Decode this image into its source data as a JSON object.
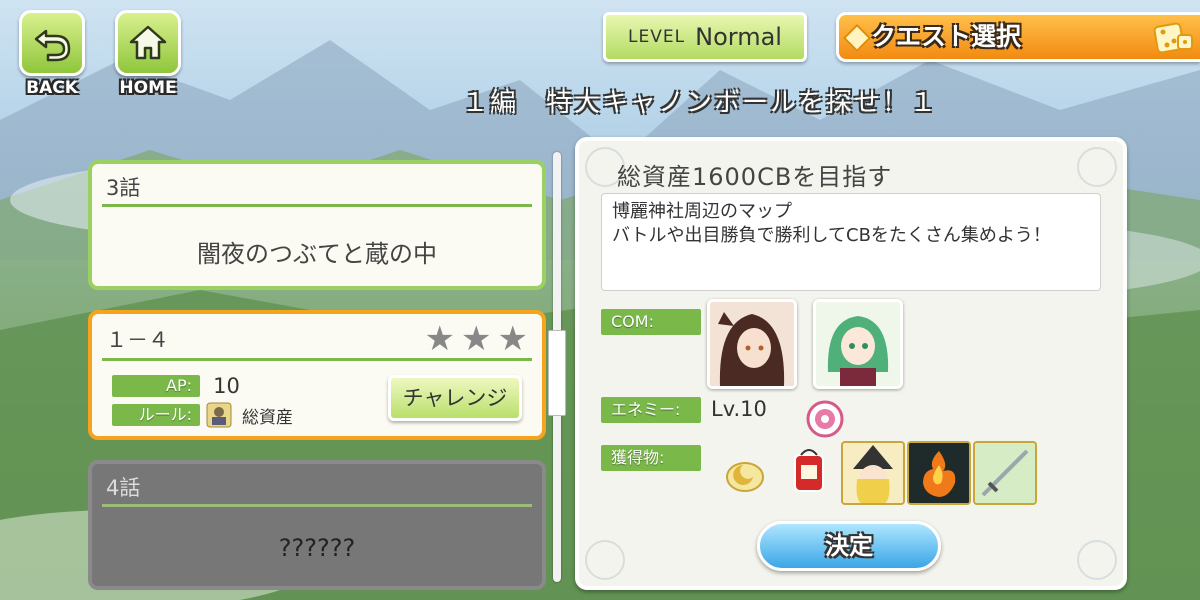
{
  "nav": {
    "back_label": "BACK",
    "home_label": "HOME"
  },
  "header": {
    "level_key": "LEVEL",
    "level_value": "Normal",
    "quest_select_label": "クエスト選択",
    "chapter_title": "１編　特大キャノンボールを探せ！１"
  },
  "episodes": [
    {
      "number": "3話",
      "name": "闇夜のつぶてと蔵の中"
    },
    {
      "number": "4話",
      "name": "??????"
    }
  ],
  "stage": {
    "number": "１－４",
    "stars": [
      "★",
      "★",
      "★"
    ],
    "ap_label": "AP:",
    "ap_value": "10",
    "rule_label": "ルール:",
    "rule_value": "総資産",
    "challenge_label": "チャレンジ"
  },
  "detail": {
    "title": "総資産1600CBを目指す",
    "description": "博麗神社周辺のマップ\nバトルや出目勝負で勝利してCBをたくさん集めよう！",
    "com_label": "COM:",
    "enemy_label": "エネミー:",
    "enemy_level": "Lv.10",
    "rewards_label": "獲得物:",
    "decide_label": "決定"
  },
  "colors": {
    "accent_green": "#7ab84a",
    "stage_border": "#f6a31e",
    "decide_blue": "#3aa6e6"
  }
}
